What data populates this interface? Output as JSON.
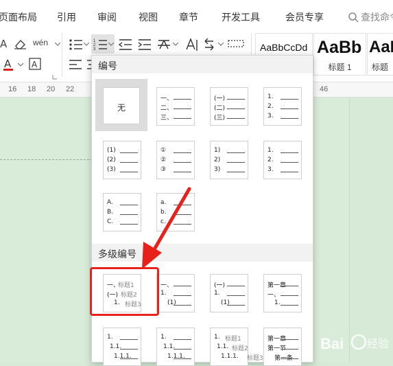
{
  "ribbon": {
    "tabs": [
      "页面布局",
      "引用",
      "审阅",
      "视图",
      "章节",
      "开发工具",
      "会员专享"
    ],
    "search_text": "查找命令"
  },
  "toolbar": {
    "pinyin_label": "wén",
    "font_color": "#e0201a"
  },
  "styles": [
    {
      "sample": "AaBbCcDd",
      "name": ""
    },
    {
      "sample": "AaBb",
      "name": "标题 1"
    },
    {
      "sample": "AaE",
      "name": "标题"
    }
  ],
  "ruler": {
    "numbers": [
      "16",
      "18",
      "20",
      "22",
      "46"
    ]
  },
  "numbering_panel": {
    "section_single": "编号",
    "section_multi": "多级编号",
    "none_label": "无",
    "single_cells": [
      [
        "一、",
        "二、",
        "三、"
      ],
      [
        "(一)",
        "(二)",
        "(三)"
      ],
      [
        "1.",
        "2.",
        "3."
      ],
      [
        "(1)",
        "(2)",
        "(3)"
      ],
      [
        "①",
        "②",
        "③"
      ],
      [
        "1)",
        "2)",
        "3)"
      ],
      [
        "1.",
        "2.",
        "3."
      ],
      [
        "A.",
        "B.",
        "C."
      ],
      [
        "a.",
        "b.",
        "c."
      ]
    ],
    "multi_cells": [
      [
        [
          "一、",
          "标题1"
        ],
        [
          "(一)",
          "标题2"
        ],
        [
          "1.",
          "标题3"
        ]
      ],
      [
        [
          "一、",
          ""
        ],
        [
          "1.",
          ""
        ],
        [
          "(1)",
          ""
        ]
      ],
      [
        [
          "(一)",
          ""
        ],
        [
          "1.",
          ""
        ],
        [
          "(1)",
          ""
        ]
      ],
      [
        [
          "第一章",
          ""
        ],
        [
          "一、",
          ""
        ],
        [
          "1.",
          ""
        ]
      ],
      [
        [
          "1.",
          ""
        ],
        [
          "1.1.",
          ""
        ],
        [
          "1.1.1.",
          ""
        ]
      ],
      [
        [
          "1.",
          ""
        ],
        [
          "1.1.",
          ""
        ],
        [
          "1.1.1.",
          ""
        ]
      ],
      [
        [
          "1.",
          "标题1"
        ],
        [
          "1.1.",
          "标题2"
        ],
        [
          "1.1.1.",
          "标题3"
        ]
      ],
      [
        [
          "第一章",
          ""
        ],
        [
          "第一节",
          ""
        ],
        [
          "第一条",
          ""
        ]
      ]
    ]
  },
  "colors": {
    "highlight_box": "#e8221b",
    "arrow": "#e8221b",
    "doc_background": "#d6ead7"
  },
  "watermark_text": "Bai 经验"
}
